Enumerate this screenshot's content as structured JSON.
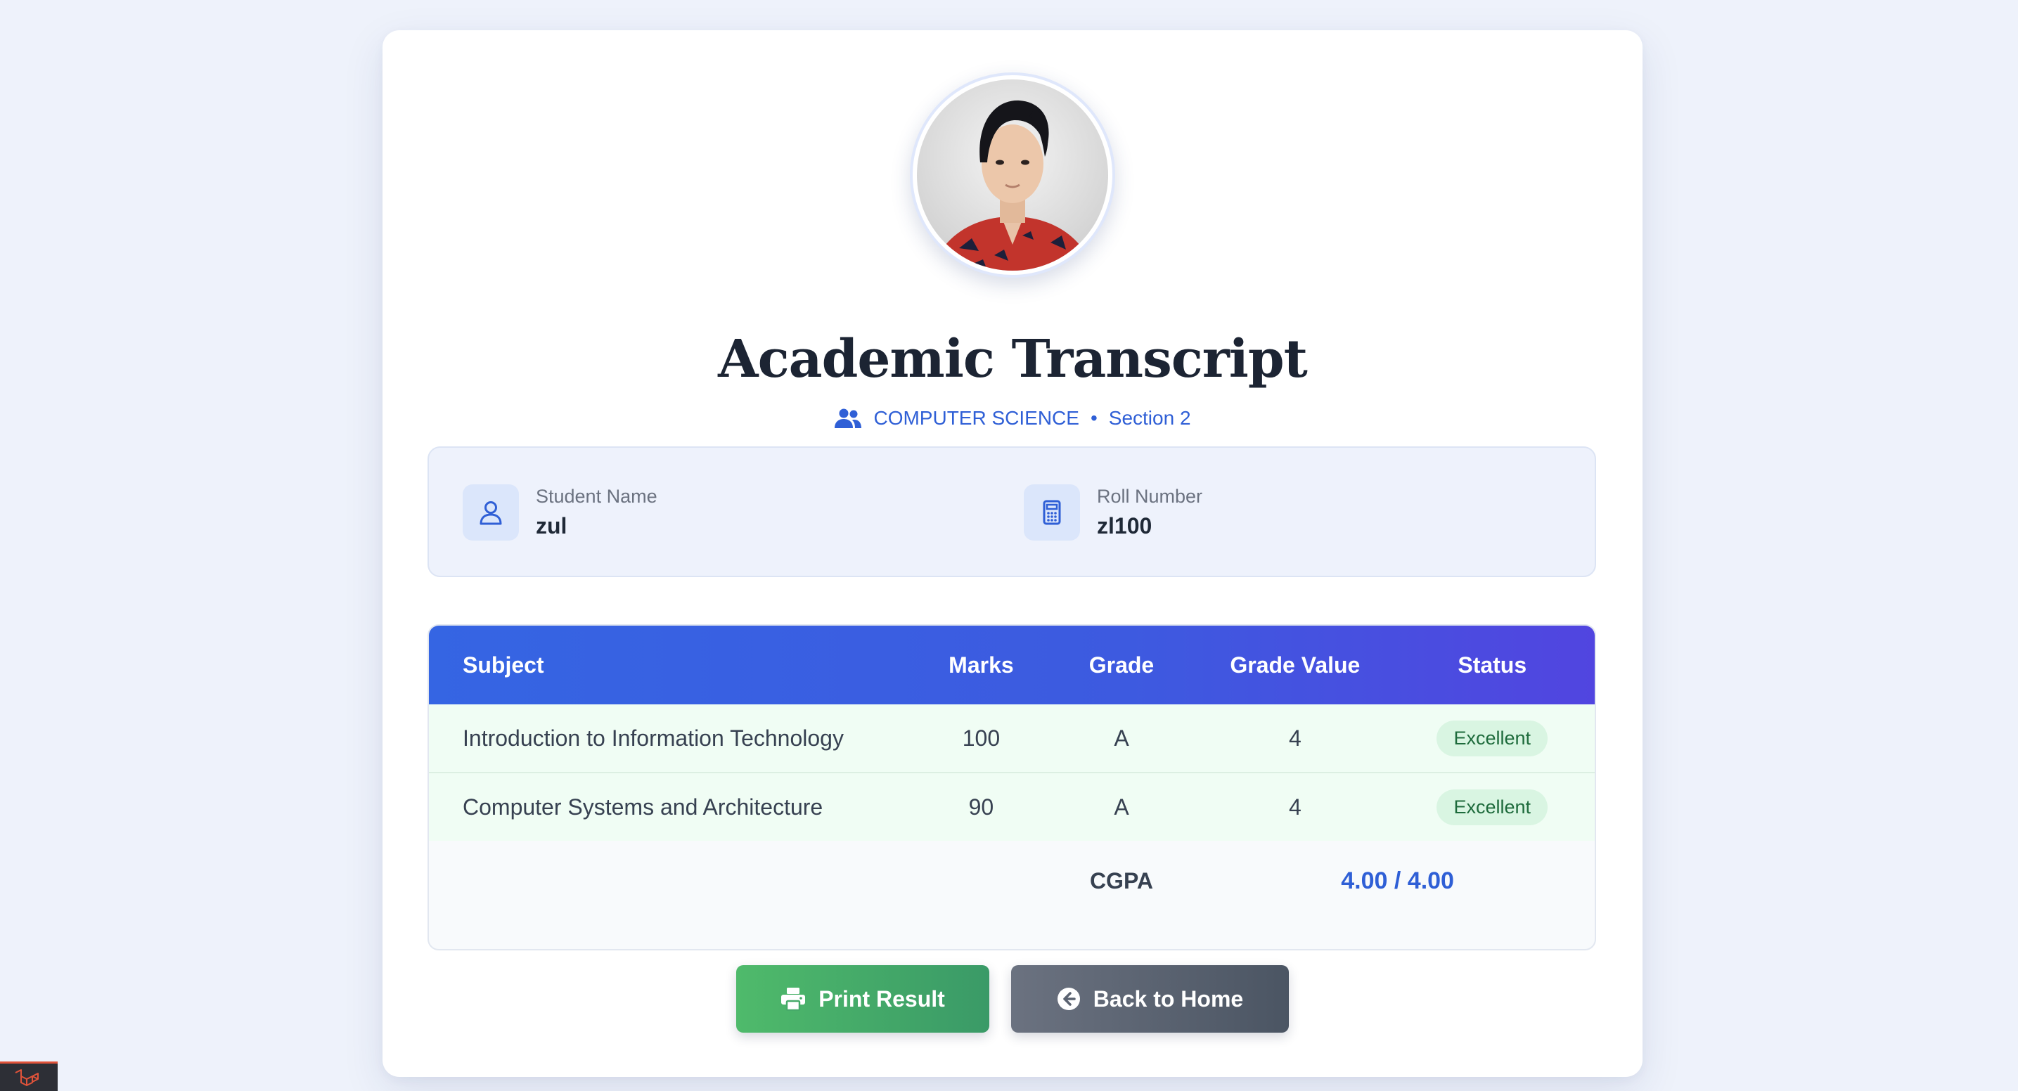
{
  "page": {
    "title": "Academic Transcript",
    "department": "COMPUTER SCIENCE",
    "separator": "•",
    "section": "Section 2"
  },
  "student": {
    "name_label": "Student Name",
    "name_value": "zul",
    "roll_label": "Roll Number",
    "roll_value": "zl100"
  },
  "table": {
    "headers": [
      "Subject",
      "Marks",
      "Grade",
      "Grade Value",
      "Status"
    ],
    "rows": [
      {
        "subject": "Introduction to Information Technology",
        "marks": "100",
        "grade": "A",
        "grade_value": "4",
        "status": "Excellent"
      },
      {
        "subject": "Computer Systems and Architecture",
        "marks": "90",
        "grade": "A",
        "grade_value": "4",
        "status": "Excellent"
      }
    ],
    "cgpa_label": "CGPA",
    "cgpa_value": "4.00 / 4.00"
  },
  "actions": {
    "print_label": "Print Result",
    "home_label": "Back to Home"
  },
  "icons": {
    "department": "users-icon",
    "student_name": "user-icon",
    "roll_number": "calculator-icon",
    "print": "printer-icon",
    "home": "arrow-circle-left-icon",
    "corner": "laravel-logo-icon"
  },
  "colors": {
    "accent": "#2f5fd6",
    "header_gradient_start": "#3565e3",
    "header_gradient_end": "#5145e0",
    "success_bg": "#d9f5e2",
    "print_button": "#4fba6b",
    "home_button": "#6b7280"
  }
}
